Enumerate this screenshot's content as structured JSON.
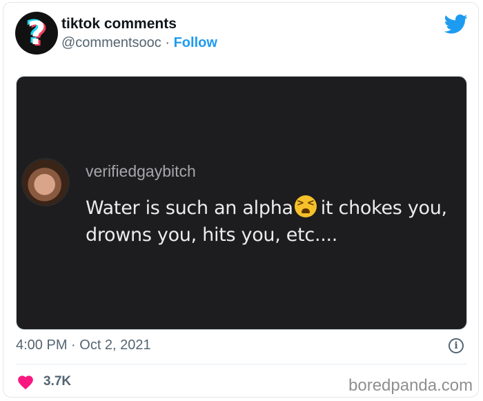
{
  "author": {
    "name": "tiktok comments",
    "handle": "@commentsooc",
    "separator": "·",
    "follow_label": "Follow",
    "avatar_glyph": "?"
  },
  "media": {
    "commenter_name": "verifiedgaybitch",
    "comment_line1_before": "Water is such an alpha",
    "comment_line1_after": "it chokes you,",
    "comment_line2": "drowns you, hits you, etc....",
    "emoji_icon": "tired-face-emoji"
  },
  "footer": {
    "timestamp": "4:00 PM · Oct 2, 2021",
    "like_count": "3.7K",
    "info_glyph": "i",
    "watermark": "boredpanda.com"
  },
  "colors": {
    "accent": "#1d9bf0",
    "heart": "#f91880",
    "media_bg": "#1d1d1f"
  }
}
